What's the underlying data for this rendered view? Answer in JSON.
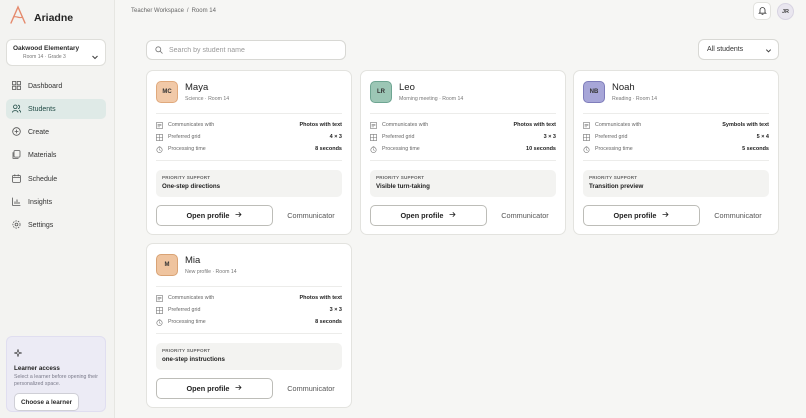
{
  "brand": {
    "name": "Ariadne",
    "accent": "#e58a6d"
  },
  "school": {
    "name": "Oakwood Elementary",
    "sub": "Room 14 · Grade 3"
  },
  "nav": [
    {
      "label": "Dashboard",
      "icon": "dashboard-icon"
    },
    {
      "label": "Students",
      "icon": "students-icon",
      "active": true
    },
    {
      "label": "Create",
      "icon": "create-icon"
    },
    {
      "label": "Materials",
      "icon": "materials-icon"
    },
    {
      "label": "Schedule",
      "icon": "schedule-icon"
    },
    {
      "label": "Insights",
      "icon": "insights-icon"
    },
    {
      "label": "Settings",
      "icon": "settings-icon"
    }
  ],
  "learner": {
    "title": "Learner access",
    "desc": "Select a learner before opening their personalized space.",
    "button": "Choose a learner"
  },
  "breadcrumb": {
    "parent": "Teacher Workspace",
    "separator": "/",
    "current": "Room 14"
  },
  "user": {
    "initials": "JR"
  },
  "search": {
    "placeholder": "Search by student name",
    "value": ""
  },
  "filter": {
    "selected": "All students"
  },
  "labels": {
    "communicates": "Communicates with",
    "grid": "Preferred grid",
    "processing": "Processing time",
    "priority": "PRIORITY SUPPORT",
    "open": "Open profile",
    "communicator": "Communicator"
  },
  "students": [
    {
      "initials": "MC",
      "name": "Maya",
      "sub": "Science · Room 14",
      "communicates": "Photos with text",
      "grid": "4 × 3",
      "processing": "8 seconds",
      "priority": "One-step directions",
      "color": "#f1c9a8"
    },
    {
      "initials": "LR",
      "name": "Leo",
      "sub": "Morning meeting · Room 14",
      "communicates": "Photos with text",
      "grid": "3 × 3",
      "processing": "10 seconds",
      "priority": "Visible turn-taking",
      "color": "#9cc6b5"
    },
    {
      "initials": "NB",
      "name": "Noah",
      "sub": "Reading · Room 14",
      "communicates": "Symbols with text",
      "grid": "5 × 4",
      "processing": "5 seconds",
      "priority": "Transition preview",
      "color": "#a7a6d8"
    },
    {
      "initials": "M",
      "name": "Mia",
      "sub": "New profile · Room 14",
      "communicates": "Photos with text",
      "grid": "3 × 3",
      "processing": "8 seconds",
      "priority": "one-step instructions",
      "color": "#efc49f"
    }
  ]
}
